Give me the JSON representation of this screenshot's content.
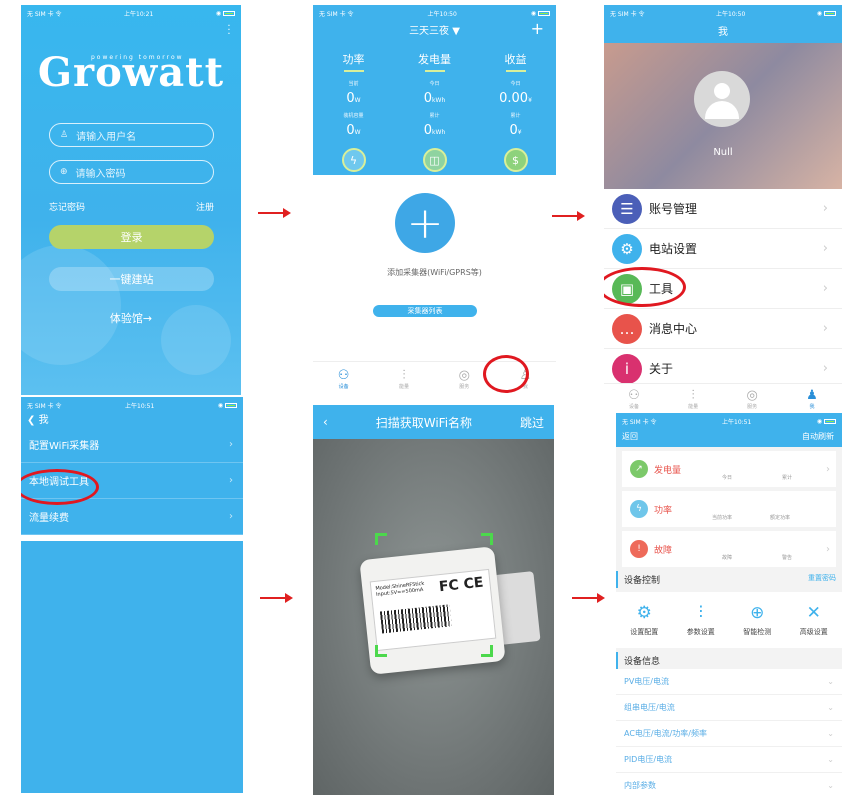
{
  "colors": {
    "accent": "#3fb2ec",
    "annotation": "#e01820"
  },
  "login": {
    "status": {
      "carrier": "无 SIM 卡 令",
      "time": "上午10:21"
    },
    "logo_text": "Growatt",
    "logo_tagline": "powering tomorrow",
    "username_placeholder": "请输入用户名",
    "password_placeholder": "请输入密码",
    "forgot": "忘记密码",
    "register": "注册",
    "login_button": "登录",
    "build_button": "一键建站",
    "experience": "体验馆→"
  },
  "plant": {
    "status": {
      "carrier": "无 SIM 卡 令",
      "time": "上午10:50"
    },
    "title": "三天三夜 ▼",
    "tabs": [
      "功率",
      "发电量",
      "收益"
    ],
    "row1": [
      {
        "label": "当前",
        "value": "0",
        "unit": "W"
      },
      {
        "label": "今日",
        "value": "0",
        "unit": "kWh"
      },
      {
        "label": "今日",
        "value": "0.00",
        "unit": "¥"
      }
    ],
    "row2": [
      {
        "label": "装机容量",
        "value": "0",
        "unit": "W"
      },
      {
        "label": "累计",
        "value": "0",
        "unit": "kWh"
      },
      {
        "label": "累计",
        "value": "0",
        "unit": "¥"
      }
    ],
    "add_text": "添加采集器(WiFi/GPRS等)",
    "list_button": "采集器列表",
    "tabbar": [
      "设备",
      "能量",
      "服务",
      "我"
    ]
  },
  "me": {
    "status": {
      "carrier": "无 SIM 卡 令",
      "time": "上午10:50"
    },
    "title": "我",
    "name": "Null",
    "items": [
      {
        "label": "账号管理",
        "icon": "account-icon",
        "color": "#4b5fb8"
      },
      {
        "label": "电站设置",
        "icon": "gear-icon",
        "color": "#3fb2ec"
      },
      {
        "label": "工具",
        "icon": "toolbox-icon",
        "color": "#58b957"
      },
      {
        "label": "消息中心",
        "icon": "message-icon",
        "color": "#e8534b"
      },
      {
        "label": "关于",
        "icon": "info-icon",
        "color": "#d9316f"
      }
    ],
    "tabbar": [
      "设备",
      "能量",
      "服务",
      "我"
    ]
  },
  "tools": {
    "status": {
      "carrier": "无 SIM 卡 令",
      "time": "上午10:51"
    },
    "back": "我",
    "items": [
      "配置WiFi采集器",
      "本地调试工具",
      "流量续费"
    ]
  },
  "scan": {
    "title": "扫描获取WiFi名称",
    "skip": "跳过",
    "label_line1": "Model:ShineRFStick",
    "label_line2": "Input:5V==500mA",
    "fc": "FC CE"
  },
  "debug": {
    "status": {
      "carrier": "无 SIM 卡 令",
      "time": "上午10:51"
    },
    "back": "返回",
    "refresh": "自动刷新",
    "cards": [
      {
        "label": "发电量",
        "sub1": "今日",
        "sub2": "累计",
        "color": "#7cc96a"
      },
      {
        "label": "功率",
        "sub1": "当前功率",
        "sub2": "额定功率",
        "color": "#6fc6ea"
      },
      {
        "label": "故障",
        "sub1": "故障",
        "sub2": "警告",
        "color": "#ee6a5a"
      }
    ],
    "control_title": "设备控制",
    "reset_password": "重置密码",
    "tools": [
      "设置配置",
      "参数设置",
      "智能检测",
      "高级设置"
    ],
    "info_title": "设备信息",
    "info_rows": [
      "PV电压/电流",
      "组串电压/电流",
      "AC电压/电流/功率/频率",
      "PID电压/电流",
      "内部参数"
    ]
  }
}
